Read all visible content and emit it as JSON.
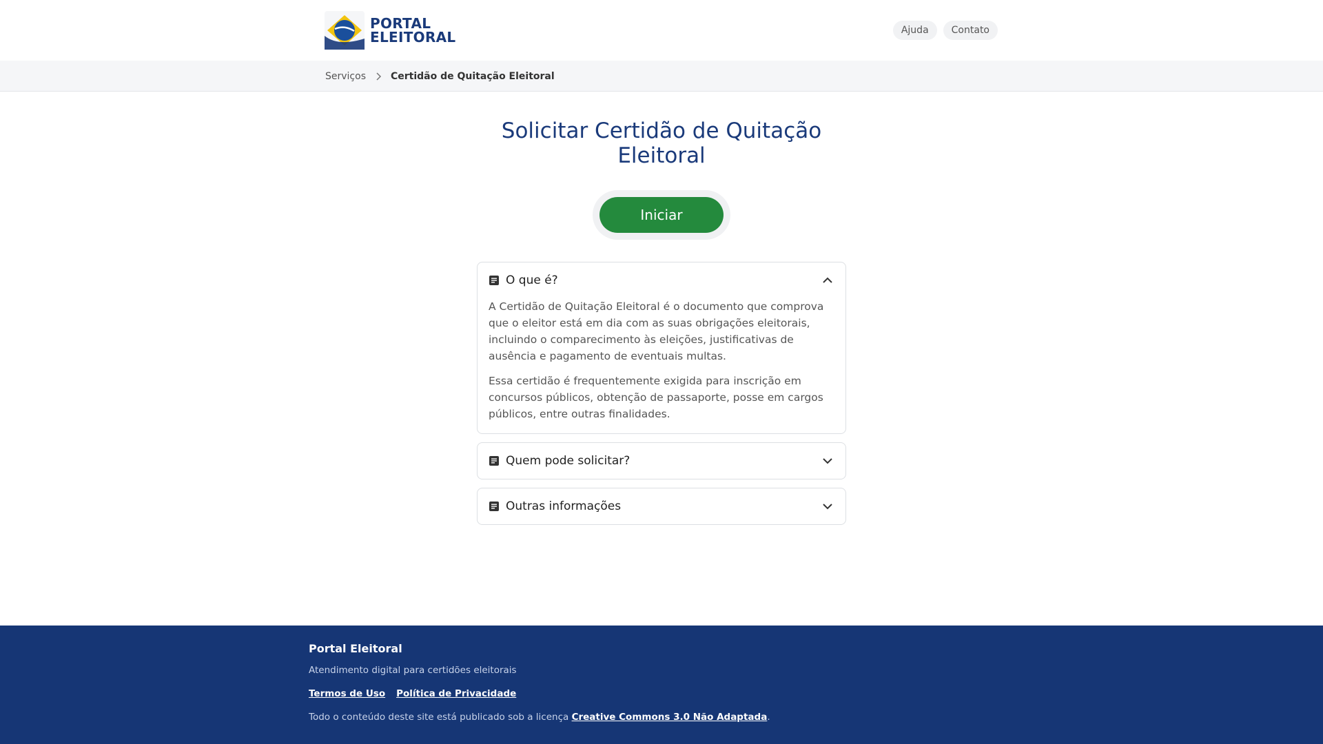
{
  "header": {
    "logo_line1": "PORTAL",
    "logo_line2": "ELEITORAL",
    "links": [
      "Ajuda",
      "Contato"
    ]
  },
  "breadcrumb": {
    "parent": "Serviços",
    "current": "Certidão de Quitação Eleitoral"
  },
  "main": {
    "title": "Solicitar Certidão de Quitação Eleitoral",
    "start_label": "Iniciar"
  },
  "accordion": [
    {
      "title": "O que é?",
      "expanded": true,
      "paragraphs": [
        "A Certidão de Quitação Eleitoral é o documento que comprova que o eleitor está em dia com as suas obrigações eleitorais, incluindo o comparecimento às eleições, justificativas de ausência e pagamento de eventuais multas.",
        "Essa certidão é frequentemente exigida para inscrição em concursos públicos, obtenção de passaporte, posse em cargos públicos, entre outras finalidades."
      ]
    },
    {
      "title": "Quem pode solicitar?",
      "expanded": false
    },
    {
      "title": "Outras informações",
      "expanded": false
    }
  ],
  "footer": {
    "title": "Portal Eleitoral",
    "subtitle": "Atendimento digital para certidões eleitorais",
    "terms": "Termos de Uso",
    "privacy": "Política de Privacidade",
    "license_prefix": "Todo o conteúdo deste site está publicado sob a licença",
    "license_link": "Creative Commons 3.0 Não Adaptada",
    "license_suffix": "."
  },
  "colors": {
    "brand_blue": "#1a3a7a",
    "footer_blue": "#163675",
    "primary_green": "#248a3d"
  }
}
